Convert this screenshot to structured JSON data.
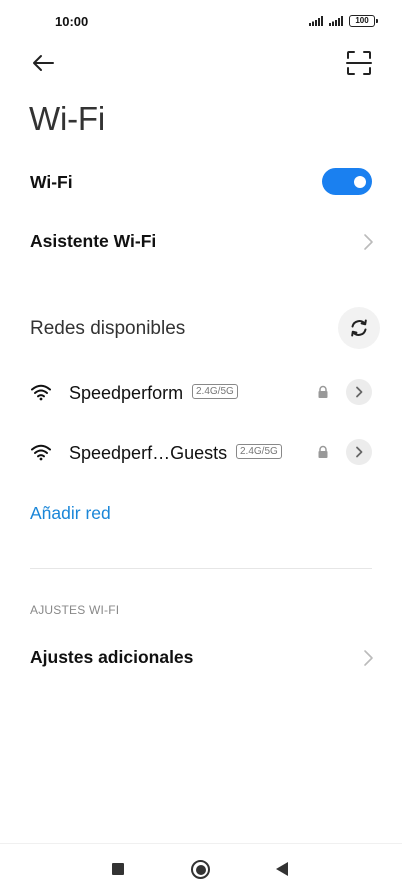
{
  "status_bar": {
    "time": "10:00",
    "battery": "100",
    "icons": [
      "signal-icon",
      "signal-icon",
      "battery-icon"
    ]
  },
  "header": {
    "back_icon": "arrow-left-icon",
    "scan_icon": "qr-scan-icon"
  },
  "page": {
    "title": "Wi-Fi"
  },
  "wifi_toggle": {
    "label": "Wi-Fi",
    "state": "on",
    "accent_color": "#1a80f0"
  },
  "assistant": {
    "label": "Asistente Wi-Fi"
  },
  "available": {
    "title": "Redes disponibles",
    "refresh_icon": "refresh-icon",
    "networks": [
      {
        "name": "Speedperform",
        "band": "2.4G/5G",
        "secured": true
      },
      {
        "name": "Speedperf…Guests",
        "band": "2.4G/5G",
        "secured": true
      }
    ],
    "add_label": "Añadir red",
    "link_color": "#1a86d8"
  },
  "settings": {
    "group_label": "AJUSTES WI-FI",
    "additional_label": "Ajustes adicionales"
  },
  "nav": {
    "icons": [
      "recents-square-icon",
      "home-circle-icon",
      "back-triangle-icon"
    ]
  }
}
